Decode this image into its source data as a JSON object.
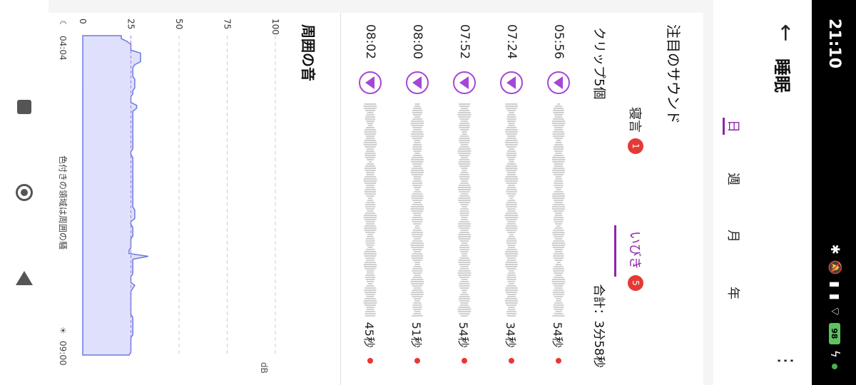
{
  "status_bar": {
    "time": "21:10",
    "battery": "98",
    "icons": [
      "bluetooth-icon",
      "mute-icon",
      "signal-icon",
      "signal-icon",
      "wifi-icon",
      "battery-icon",
      "charging-icon"
    ]
  },
  "header": {
    "title": "睡眠",
    "back_icon": "back-arrow-icon",
    "more_icon": "more-icon"
  },
  "period_tabs": [
    {
      "label": "日",
      "active": true
    },
    {
      "label": "週",
      "active": false
    },
    {
      "label": "月",
      "active": false
    },
    {
      "label": "年",
      "active": false
    }
  ],
  "sounds": {
    "title": "注目のサウンド",
    "tabs": [
      {
        "label": "寝言",
        "badge": "1",
        "active": false
      },
      {
        "label": "いびき",
        "badge": "5",
        "active": true
      }
    ],
    "clip_count": "クリップ5個",
    "total": "合計：3分58秒",
    "clips": [
      {
        "time": "05:56",
        "duration": "54秒"
      },
      {
        "time": "07:24",
        "duration": "34秒"
      },
      {
        "time": "07:52",
        "duration": "54秒"
      },
      {
        "time": "08:00",
        "duration": "51秒"
      },
      {
        "time": "08:02",
        "duration": "45秒"
      }
    ],
    "accent_color": "#a646d6",
    "dot_color": "#e53935"
  },
  "ambient": {
    "title": "周囲の音",
    "unit": "dB",
    "start_time": "04:04",
    "end_time": "09:00",
    "note": "色付きの領域は周囲の騒"
  },
  "chart_data": {
    "type": "area",
    "title": "周囲の音",
    "ylabel": "dB",
    "y_ticks": [
      0,
      25,
      50,
      75,
      100
    ],
    "ylim": [
      0,
      100
    ],
    "x_start": "04:04",
    "x_end": "09:00",
    "threshold": 25,
    "grid": true,
    "values": [
      20,
      20,
      23,
      25,
      25,
      25,
      30,
      30,
      30,
      30,
      27,
      26,
      26,
      26,
      26,
      27,
      27,
      27,
      27,
      26,
      26,
      25,
      25,
      25,
      28,
      28,
      26,
      26,
      26,
      26,
      26,
      26,
      26,
      26,
      26,
      26,
      26,
      26,
      26,
      26,
      25,
      25,
      26,
      26,
      26,
      26,
      26,
      26,
      26,
      26,
      26,
      26,
      26,
      26,
      26,
      26,
      26,
      26,
      26,
      26,
      27,
      27,
      27,
      27,
      25,
      25,
      26,
      26,
      26,
      26,
      25,
      25,
      25,
      25,
      24,
      24,
      34,
      26,
      26,
      26,
      26,
      26,
      26,
      25,
      25,
      25,
      27,
      26,
      25,
      25,
      25,
      25,
      25,
      25,
      25,
      25,
      25,
      26,
      26,
      26,
      26,
      26,
      26,
      26,
      25,
      25,
      25,
      25,
      25,
      25,
      24
    ]
  },
  "nav": [
    "recent-apps-icon",
    "home-icon",
    "back-icon"
  ]
}
